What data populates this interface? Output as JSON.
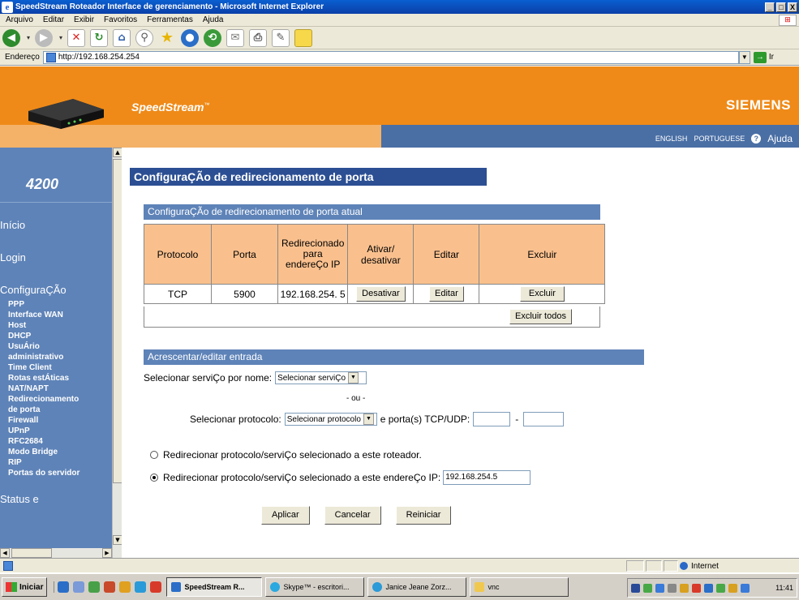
{
  "window": {
    "title": "SpeedStream Roteador Interface de gerenciamento - Microsoft Internet Explorer",
    "min_label": "_",
    "max_label": "□",
    "close_label": "X"
  },
  "menu": [
    "Arquivo",
    "Editar",
    "Exibir",
    "Favoritos",
    "Ferramentas",
    "Ajuda"
  ],
  "address": {
    "label": "Endereço",
    "url": "http://192.168.254.254",
    "go_label": "Ir"
  },
  "banner": {
    "brand": "SpeedStream",
    "brand_mark": "™",
    "vendor": "SIEMENS",
    "lang_english": "ENGLISH",
    "lang_portuguese": "PORTUGUESE",
    "help": "Ajuda"
  },
  "sidebar": {
    "model": "4200",
    "inicio": "Início",
    "login": "Login",
    "configuracao": "ConfiguraÇÃo",
    "items": [
      "PPP",
      "Interface WAN",
      "Host",
      "DHCP",
      "UsuÁrio",
      "administrativo",
      "Time Client",
      "Rotas estÁticas",
      "NAT/NAPT",
      "Redirecionamento",
      "de porta",
      "Firewall",
      "UPnP",
      "RFC2684",
      "Modo Bridge",
      "RIP",
      "Portas do servidor"
    ],
    "status_cutoff": "Status e"
  },
  "main": {
    "page_title": "ConfiguraÇÃo de redirecionamento de porta",
    "current_section": "ConfiguraÇÃo de redirecionamento de porta atual",
    "table": {
      "headers": [
        "Protocolo",
        "Porta",
        "Redirecionado para endereÇo IP",
        "Ativar/ desativar",
        "Editar",
        "Excluir"
      ],
      "rows": [
        {
          "protocolo": "TCP",
          "porta": "5900",
          "ip": "192.168.254. 5",
          "toggle": "Desativar",
          "edit": "Editar",
          "delete": "Excluir"
        }
      ],
      "delete_all": "Excluir todos"
    },
    "add_section": "Acrescentar/editar entrada",
    "select_service_label": "Selecionar serviÇo por nome:",
    "select_service_value": "Selecionar serviÇo",
    "or_text": "- ou -",
    "select_protocol_label": "Selecionar protocolo:",
    "select_protocol_value": "Selecionar protocolo",
    "ports_label": "e porta(s) TCP/UDP:",
    "port_dash": "-",
    "port_from": "",
    "port_to": "",
    "radio_router": "Redirecionar protocolo/serviÇo selecionado a este roteador.",
    "radio_ip": "Redirecionar protocolo/serviÇo selecionado a este endereÇo IP:",
    "ip_value": "192.168.254.5",
    "selected_radio": "ip",
    "buttons": {
      "apply": "Aplicar",
      "cancel": "Cancelar",
      "restart": "Reiniciar"
    }
  },
  "status": {
    "zone": "Internet"
  },
  "taskbar": {
    "start": "Iniciar",
    "tasks": [
      "SpeedStream R...",
      "Skype™ - escritori...",
      "Janice Jeane Zorz...",
      "vnc"
    ],
    "clock": "11:41"
  },
  "colors": {
    "orange": "#ef8a18",
    "light_orange": "#f4b168",
    "nav_blue": "#5e83b8",
    "title_blue": "#2c4f93",
    "table_header": "#f9c08e"
  }
}
